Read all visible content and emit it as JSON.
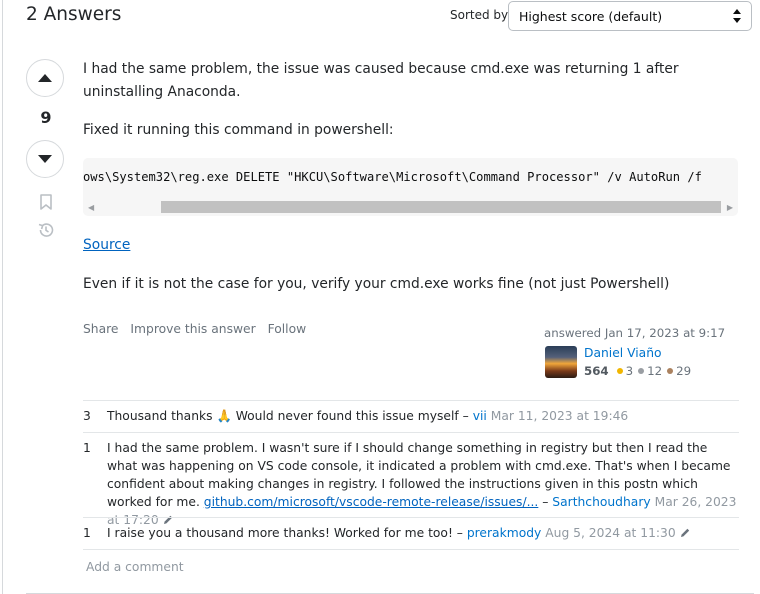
{
  "header": {
    "answers_count": "2 Answers",
    "sort_label": "Sorted by:",
    "sort_value": "Highest score (default)"
  },
  "votes": {
    "score": "9"
  },
  "answer": {
    "paragraph1": "I had the same problem, the issue was caused because cmd.exe was returning 1 after uninstalling Anaconda.",
    "paragraph2": "Fixed it running this command in powershell:",
    "code": "ows\\System32\\reg.exe DELETE \"HKCU\\Software\\Microsoft\\Command Processor\" /v AutoRun /f",
    "source_link": "Source",
    "paragraph3": "Even if it is not the case for you, verify your cmd.exe works fine (not just Powershell)"
  },
  "post_menu": {
    "share": "Share",
    "improve": "Improve this answer",
    "follow": "Follow"
  },
  "user_card": {
    "action": "answered Jan 17, 2023 at 9:17",
    "name": "Daniel Viaño",
    "reputation": "564",
    "gold_badges": "3",
    "silver_badges": "12",
    "bronze_badges": "29",
    "badge_colors": {
      "gold": "#f1b600",
      "silver": "#9a9ea3",
      "bronze": "#ab825f"
    }
  },
  "comments": [
    {
      "score": "3",
      "text": "Thousand thanks",
      "emoji": "🙏",
      "text2": "Would never found this issue myself",
      "user": "vii",
      "date": "Mar 11, 2023 at 19:46"
    },
    {
      "score": "1",
      "text": "I had the same problem. I wasn't sure if I should change something in registry but then I read the what was happening on VS code console, it indicated a problem with cmd.exe. That's when I became confident about making changes in registry. I followed the instructions given in this postn which worked for me.",
      "link": "github.com/microsoft/vscode-remote-release/issues/...",
      "user": "Sarthchoudhary",
      "date": "Mar 26, 2023 at 17:20"
    },
    {
      "score": "1",
      "text": "I raise you a thousand more thanks! Worked for me too!",
      "user": "prerakmody",
      "date": "Aug 5, 2024 at 11:30"
    }
  ],
  "add_comment": "Add a comment",
  "colors": {
    "link": "#0063bf",
    "user_link": "#0074cc",
    "muted": "#6a737c",
    "border": "#d6d9dc"
  }
}
